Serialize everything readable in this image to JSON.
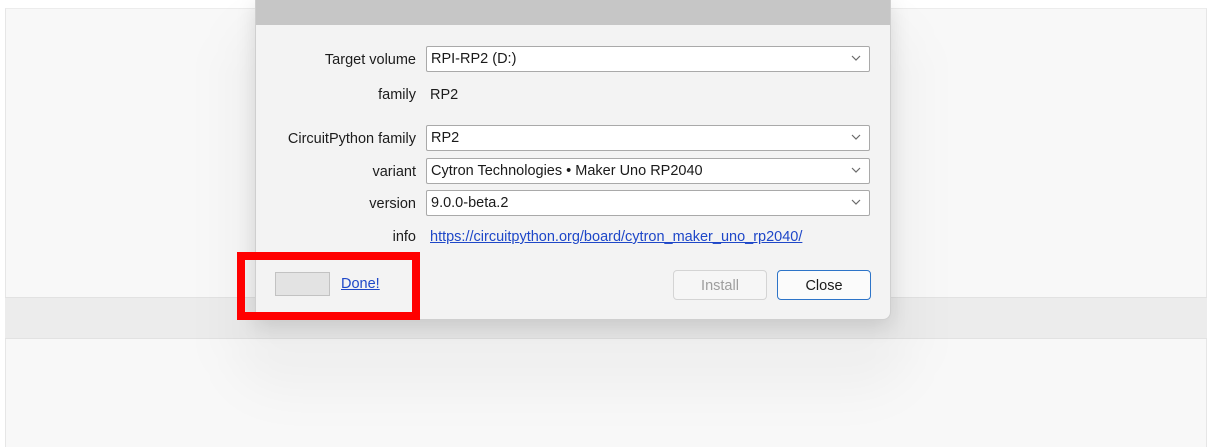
{
  "dialog": {
    "target_volume": {
      "label": "Target volume",
      "value": "RPI-RP2 (D:)"
    },
    "family": {
      "label": "family",
      "value": "RP2"
    },
    "circuitpython_family": {
      "label": "CircuitPython family",
      "value": "RP2"
    },
    "variant": {
      "label": "variant",
      "value": "Cytron Technologies • Maker Uno RP2040"
    },
    "version": {
      "label": "version",
      "value": "9.0.0-beta.2"
    },
    "info": {
      "label": "info",
      "link_text": "https://circuitpython.org/board/cytron_maker_uno_rp2040/"
    },
    "status_link": "Done!",
    "buttons": {
      "install": "Install",
      "close": "Close"
    }
  },
  "colors": {
    "link": "#1e47c8",
    "highlight": "#ff0000",
    "focus_border": "#2d74c8"
  },
  "icons": {
    "dropdown": "chevron-down-icon"
  }
}
